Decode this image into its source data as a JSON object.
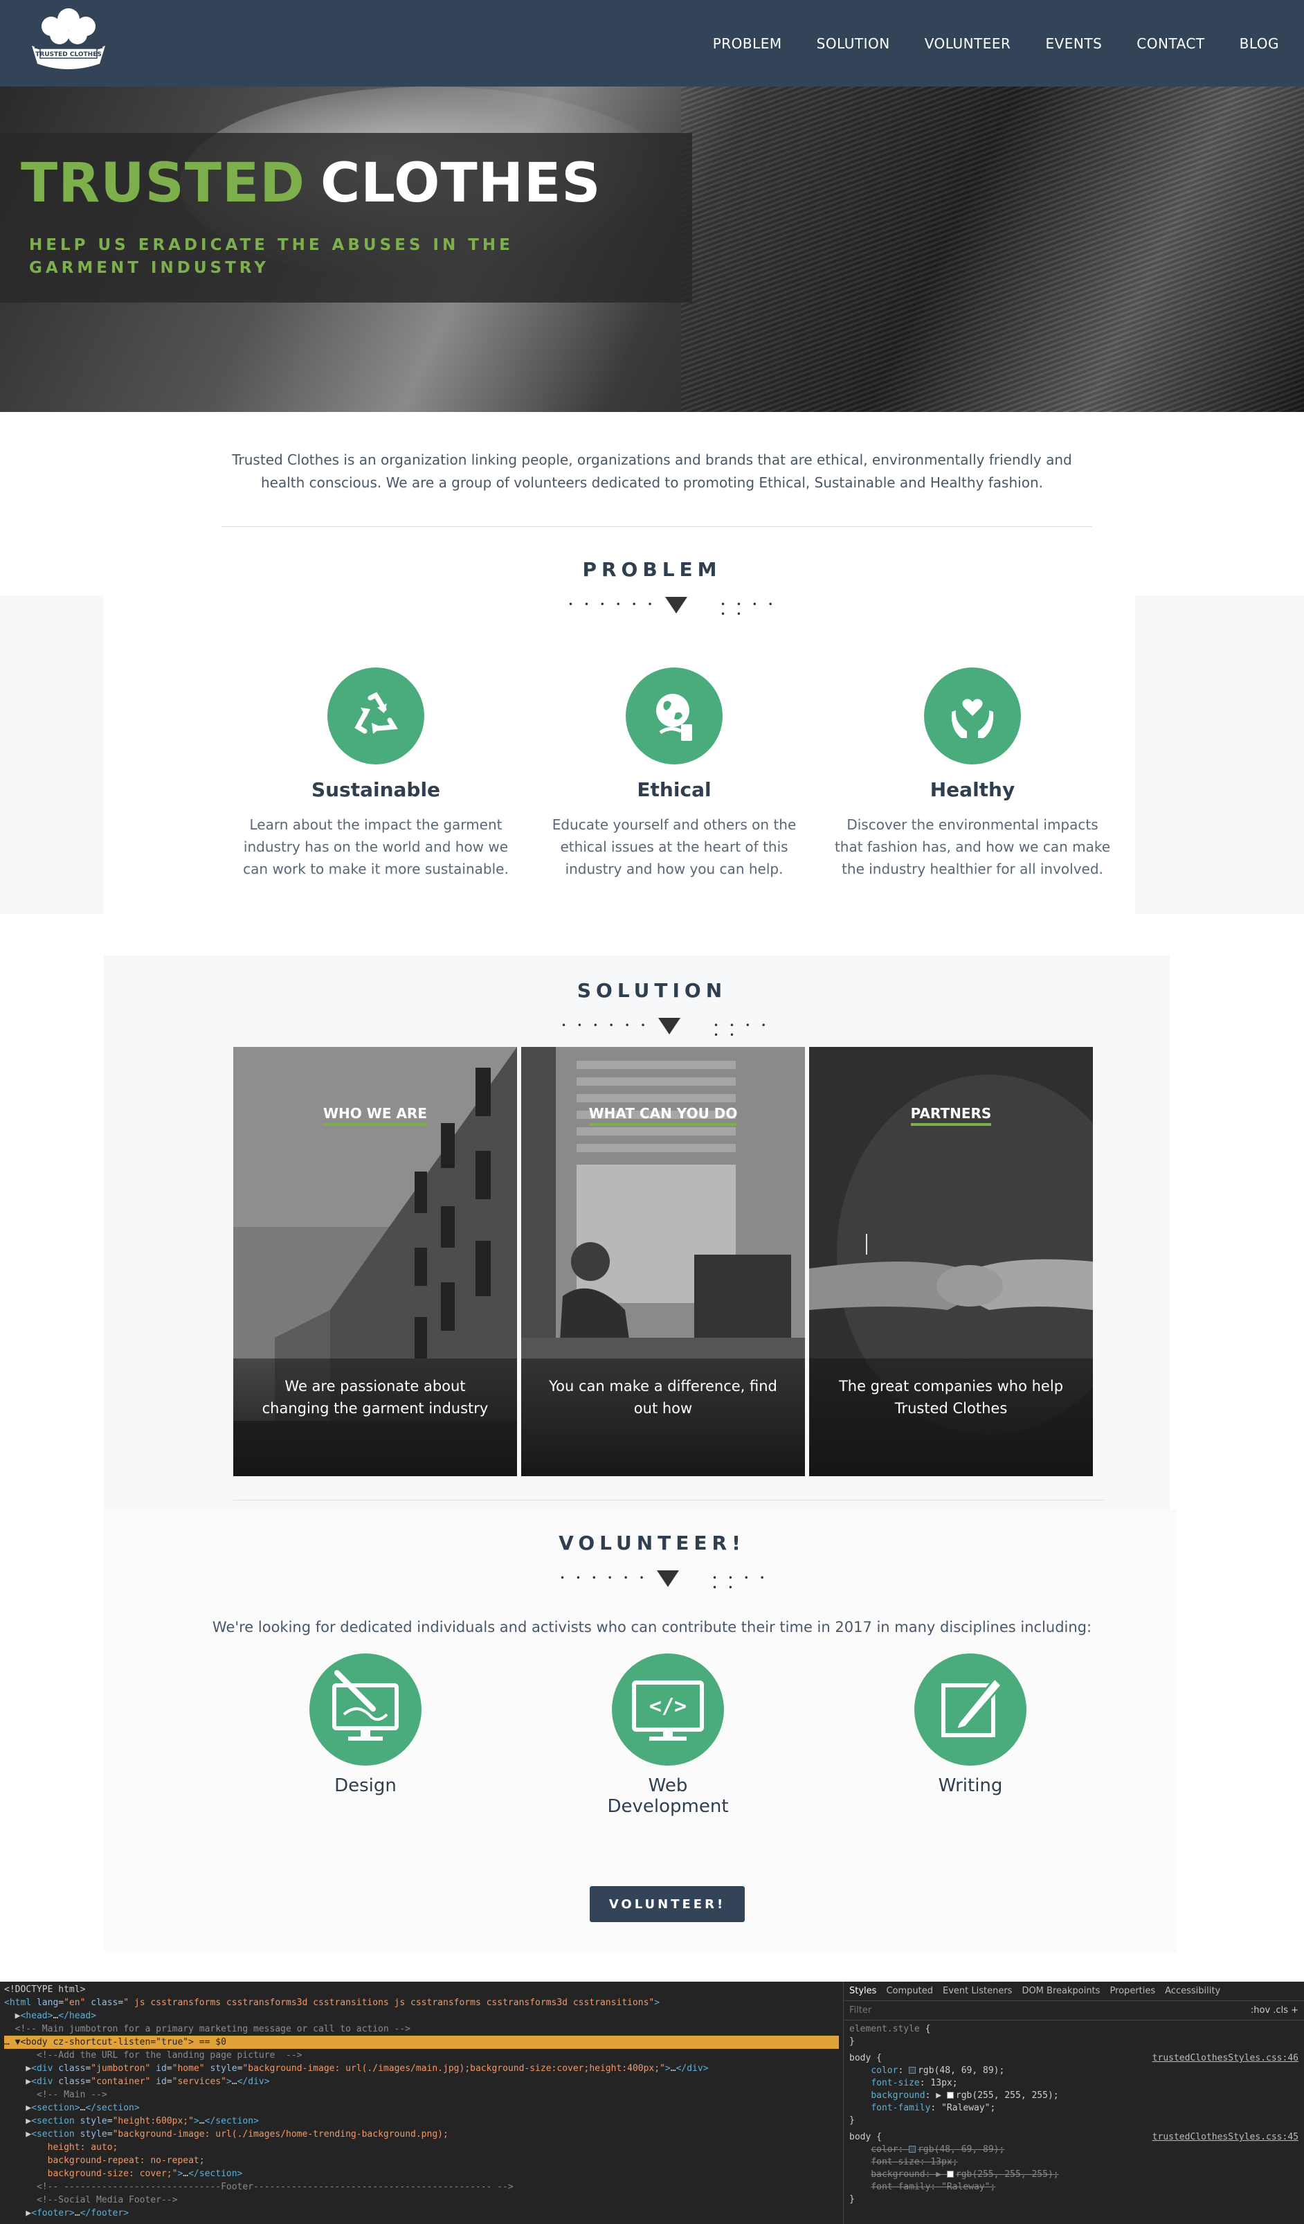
{
  "nav": {
    "logo_text": "TRUSTED CLOTHES",
    "links": [
      "PROBLEM",
      "SOLUTION",
      "VOLUNTEER",
      "EVENTS",
      "CONTACT",
      "BLOG"
    ]
  },
  "hero": {
    "title_1": "TRUSTED",
    "title_2": "CLOTHES",
    "subtitle": "HELP US ERADICATE THE ABUSES IN THE GARMENT INDUSTRY"
  },
  "intro": "Trusted Clothes is an organization linking people, organizations and brands that are ethical, environmentally friendly and health conscious. We are a group of volunteers dedicated to promoting Ethical, Sustainable and Healthy fashion.",
  "problem": {
    "title": "PROBLEM",
    "items": [
      {
        "title": "Sustainable",
        "text": "Learn about the impact the garment industry has on the world and how we can work to make it more sustainable.",
        "icon": "recycle-icon"
      },
      {
        "title": "Ethical",
        "text": "Educate yourself and others on the ethical issues at the heart of this industry and how you can help.",
        "icon": "globe-hand-icon"
      },
      {
        "title": "Healthy",
        "text": "Discover the environmental impacts that fashion has, and how we can make the industry healthier for all involved.",
        "icon": "heart-hands-icon"
      }
    ]
  },
  "solution": {
    "title": "SOLUTION",
    "cards": [
      {
        "heading": "WHO WE ARE",
        "text": "We are passionate about changing the garment industry"
      },
      {
        "heading": "WHAT CAN YOU DO",
        "text": "You can make a difference, find out how"
      },
      {
        "heading": "PARTNERS",
        "text": "The great companies who help Trusted Clothes"
      }
    ]
  },
  "volunteer": {
    "title": "VOLUNTEER!",
    "intro": "We're looking for dedicated individuals and activists who can contribute their time in 2017 in many disciplines including:",
    "skills": [
      {
        "label": "Design",
        "icon": "design-monitor-icon"
      },
      {
        "label": "Web Development",
        "icon": "code-monitor-icon"
      },
      {
        "label": "Writing",
        "icon": "pencil-square-icon"
      }
    ],
    "button": "VOLUNTEER!"
  },
  "devtools": {
    "tabs": [
      "Styles",
      "Computed",
      "Event Listeners",
      "DOM Breakpoints",
      "Properties",
      "Accessibility"
    ],
    "filter_placeholder": "Filter",
    "filter_tools": ":hov  .cls  +",
    "source_1": "trustedClothesStyles.css:46",
    "source_2": "trustedClothesStyles.css:45"
  }
}
